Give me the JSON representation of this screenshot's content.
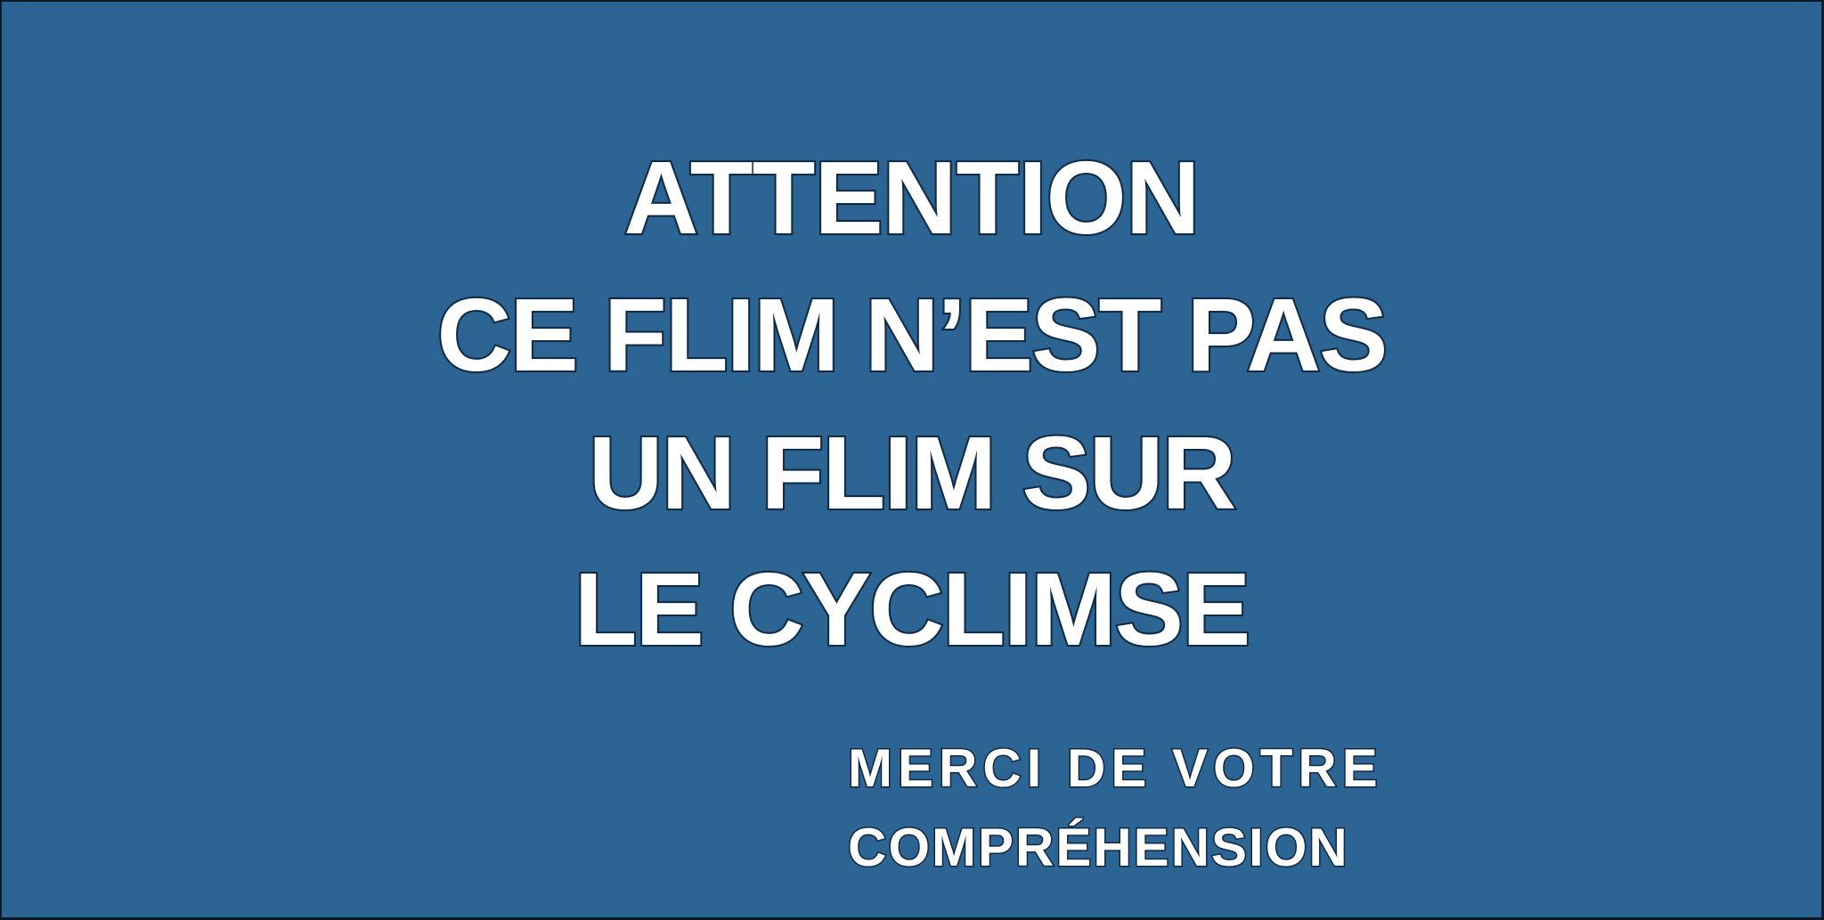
{
  "sign": {
    "background_color": "#2c6593",
    "text_color": "#ffffff",
    "outline_color": "#0f2740",
    "headline_lines": [
      "ATTENTION",
      "CE FLIM N’EST PAS",
      "UN FLIM SUR",
      "LE CYCLIMSE"
    ],
    "footer_lines": [
      "MERCI DE VOTRE",
      "COMPRÉHENSION"
    ]
  }
}
